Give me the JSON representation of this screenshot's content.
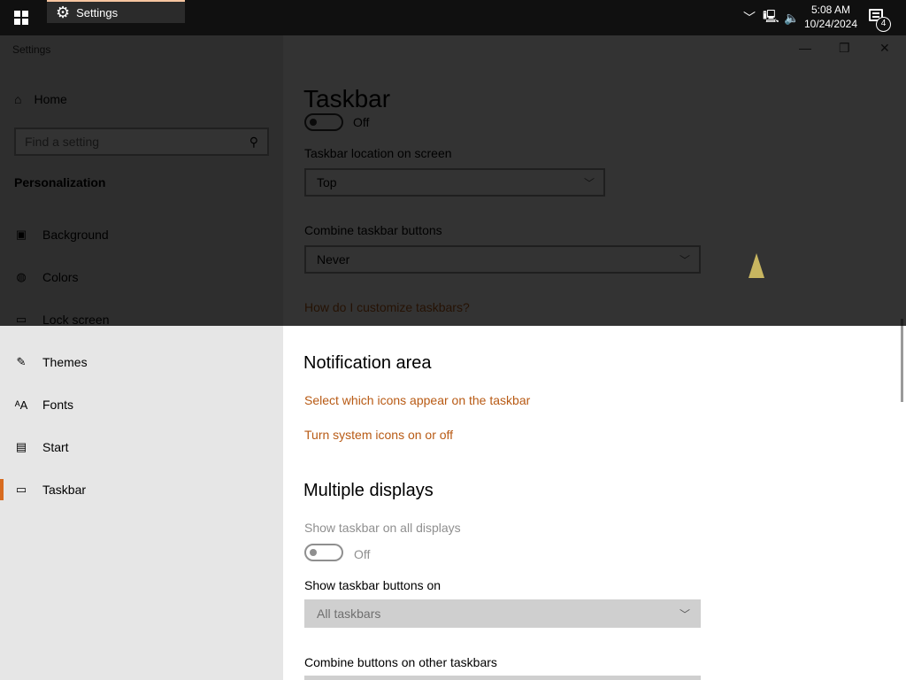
{
  "taskbar": {
    "app_label": "Settings",
    "clock_time": "5:08 AM",
    "clock_date": "10/24/2024",
    "notification_count": "4"
  },
  "window": {
    "title": "Settings",
    "minimize": "—",
    "maximize": "❐",
    "close": "✕"
  },
  "sidebar": {
    "home_label": "Home",
    "search_placeholder": "Find a setting",
    "section_label": "Personalization",
    "items": [
      {
        "label": "Background",
        "icon": "background-icon"
      },
      {
        "label": "Colors",
        "icon": "palette-icon"
      },
      {
        "label": "Lock screen",
        "icon": "lock-screen-icon"
      },
      {
        "label": "Themes",
        "icon": "themes-icon"
      },
      {
        "label": "Fonts",
        "icon": "fonts-icon"
      },
      {
        "label": "Start",
        "icon": "start-icon"
      },
      {
        "label": "Taskbar",
        "icon": "taskbar-icon"
      }
    ]
  },
  "main": {
    "title": "Taskbar",
    "top_toggle_state": "Off",
    "location_label": "Taskbar location on screen",
    "location_value": "Top",
    "combine_label": "Combine taskbar buttons",
    "combine_value": "Never",
    "customize_link": "How do I customize taskbars?",
    "notification_title": "Notification area",
    "notif_link_icons": "Select which icons appear on the taskbar",
    "notif_link_system": "Turn system icons on or off",
    "multi_title": "Multiple displays",
    "show_all_label": "Show taskbar on all displays",
    "show_all_state": "Off",
    "show_buttons_label": "Show taskbar buttons on",
    "show_buttons_value": "All taskbars",
    "combine_other_label": "Combine buttons on other taskbars"
  },
  "colors": {
    "accent": "#d86b1f",
    "link": "#b85a14"
  }
}
